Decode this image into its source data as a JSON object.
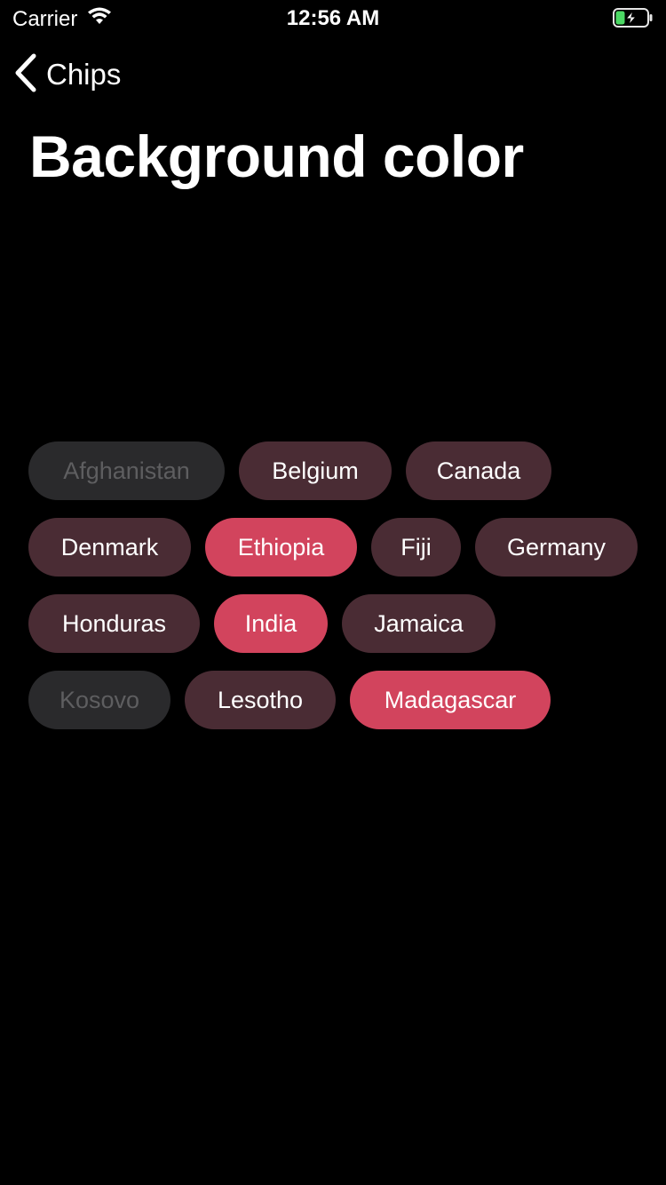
{
  "status_bar": {
    "carrier": "Carrier",
    "time": "12:56 AM",
    "battery_icon": "battery-charging-icon",
    "wifi_icon": "wifi-icon"
  },
  "nav": {
    "back_label": "Chips",
    "back_icon": "chevron-left-icon"
  },
  "title": "Background color",
  "colors": {
    "background": "#000000",
    "chip_normal": "#4a2c34",
    "chip_selected": "#d2445d",
    "chip_disabled": "#2a2a2c",
    "chip_disabled_text": "#5e5e60",
    "battery_green": "#4cd964"
  },
  "chips": {
    "row1": [
      {
        "label": "Afghanistan",
        "state": "disabled"
      },
      {
        "label": "Belgium",
        "state": "normal"
      },
      {
        "label": "Canada",
        "state": "normal"
      }
    ],
    "row2": [
      {
        "label": "Denmark",
        "state": "normal"
      },
      {
        "label": "Ethiopia",
        "state": "selected"
      },
      {
        "label": "Fiji",
        "state": "normal"
      },
      {
        "label": "Germany",
        "state": "normal"
      }
    ],
    "row3": [
      {
        "label": "Honduras",
        "state": "normal"
      },
      {
        "label": "India",
        "state": "selected"
      },
      {
        "label": "Jamaica",
        "state": "normal"
      }
    ],
    "row4": [
      {
        "label": "Kosovo",
        "state": "disabled"
      },
      {
        "label": "Lesotho",
        "state": "normal"
      },
      {
        "label": "Madagascar",
        "state": "selected"
      }
    ]
  }
}
